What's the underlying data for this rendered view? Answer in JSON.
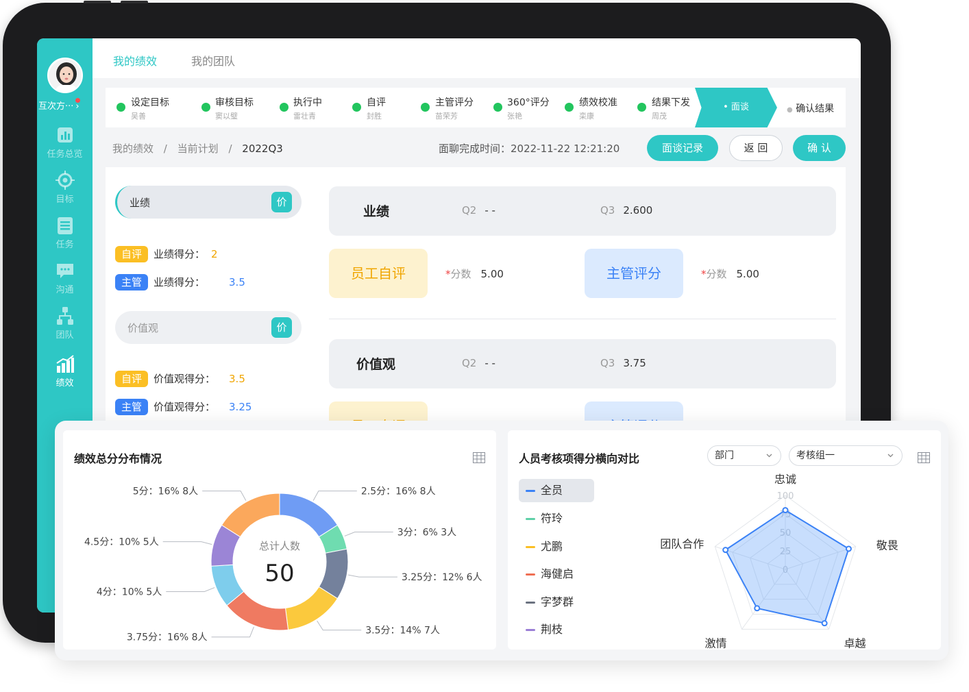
{
  "app": {
    "user_name": "互次方···",
    "tabs": [
      "我的绩效",
      "我的团队"
    ],
    "nav": [
      {
        "label": "任务总览",
        "icon": "bar-chart-icon"
      },
      {
        "label": "目标",
        "icon": "target-icon"
      },
      {
        "label": "任务",
        "icon": "list-icon"
      },
      {
        "label": "沟通",
        "icon": "chat-icon"
      },
      {
        "label": "团队",
        "icon": "org-chart-icon"
      },
      {
        "label": "绩效",
        "icon": "performance-chart-icon"
      }
    ]
  },
  "stepper": {
    "steps": [
      {
        "title": "设定目标",
        "sub": "吴善"
      },
      {
        "title": "审核目标",
        "sub": "窦以璧"
      },
      {
        "title": "执行中",
        "sub": "雷壮青"
      },
      {
        "title": "自评",
        "sub": "封胜"
      },
      {
        "title": "主管评分",
        "sub": "苗荣芳"
      },
      {
        "title": "360°评分",
        "sub": "张艳"
      },
      {
        "title": "绩效校准",
        "sub": "栾康"
      },
      {
        "title": "结果下发",
        "sub": "周茂"
      }
    ],
    "active": "面谈",
    "last": "确认结果"
  },
  "breadcrumb": {
    "items": [
      "我的绩效",
      "当前计划",
      "2022Q3"
    ],
    "sep": "/"
  },
  "header": {
    "done_time": "面聊完成时间：2022-11-22 12:21:20",
    "btn_record": "面谈记录",
    "btn_back": "返 回",
    "btn_confirm": "确 认"
  },
  "left_panel": {
    "pill1": {
      "label": "业绩",
      "tag": "价"
    },
    "pill2": {
      "label": "价值观",
      "tag": "价"
    },
    "self_badge": "自评",
    "mgr_badge": "主管",
    "perf_label": "业绩得分：",
    "perf_self": "2",
    "perf_mgr": "3.5",
    "value_label": "价值观得分：",
    "value_self": "3.5",
    "value_mgr": "3.25"
  },
  "sections": [
    {
      "title": "业绩",
      "q2_label": "Q2",
      "q2": "- -",
      "q3_label": "Q3",
      "q3": "2.600"
    },
    {
      "title": "价值观",
      "q2_label": "Q2",
      "q2": "- -",
      "q3_label": "Q3",
      "q3": "3.75"
    }
  ],
  "eval": {
    "self": "员工自评",
    "mgr": "主管评分",
    "star": "*",
    "score_label": "分数",
    "self_score": "5.00",
    "mgr_score": "5.00"
  },
  "donut_card": {
    "title": "绩效总分分布情况",
    "center_label": "总计人数",
    "center_value": "50"
  },
  "radar_card": {
    "title": "人员考核项得分横向对比",
    "select1": "部门",
    "select2": "考核组一",
    "legend": [
      {
        "name": "全员",
        "color": "#3b82f6"
      },
      {
        "name": "符玲",
        "color": "#5fd0a8"
      },
      {
        "name": "尤鹏",
        "color": "#fbbf24"
      },
      {
        "name": "海健启",
        "color": "#ef6f53"
      },
      {
        "name": "字梦群",
        "color": "#6b7280"
      },
      {
        "name": "荆枝",
        "color": "#9b7fd6"
      }
    ]
  },
  "chart_data": [
    {
      "type": "pie",
      "title": "绩效总分分布情况",
      "categories": [
        "2.5分",
        "3分",
        "3.25分",
        "3.5分",
        "3.75分",
        "4分",
        "4.5分",
        "5分"
      ],
      "values": [
        16,
        6,
        12,
        14,
        16,
        10,
        10,
        16
      ],
      "counts": [
        8,
        3,
        6,
        7,
        8,
        5,
        5,
        8
      ],
      "labels": [
        "2.5分：16%  8人",
        "3分：6%  3人",
        "3.25分：12%  6人",
        "3.5分：14%  7人",
        "3.75分：16%  8人",
        "4分：10%  5人",
        "4.5分：10%  5人",
        "5分：16%  8人"
      ],
      "colors": [
        "#6f9cf4",
        "#6fdcb0",
        "#74819c",
        "#fbc93d",
        "#ef7a61",
        "#7ecdec",
        "#9b85d6",
        "#fba85c"
      ]
    },
    {
      "type": "radar",
      "title": "人员考核项得分横向对比",
      "axes": [
        "忠诚",
        "敬畏",
        "卓越",
        "激情",
        "团队合作"
      ],
      "ticks": [
        "0",
        "25",
        "50",
        "75",
        "100"
      ],
      "rmax": 100,
      "series": [
        {
          "name": "全员",
          "values": [
            80,
            90,
            90,
            65,
            85
          ]
        }
      ]
    }
  ]
}
